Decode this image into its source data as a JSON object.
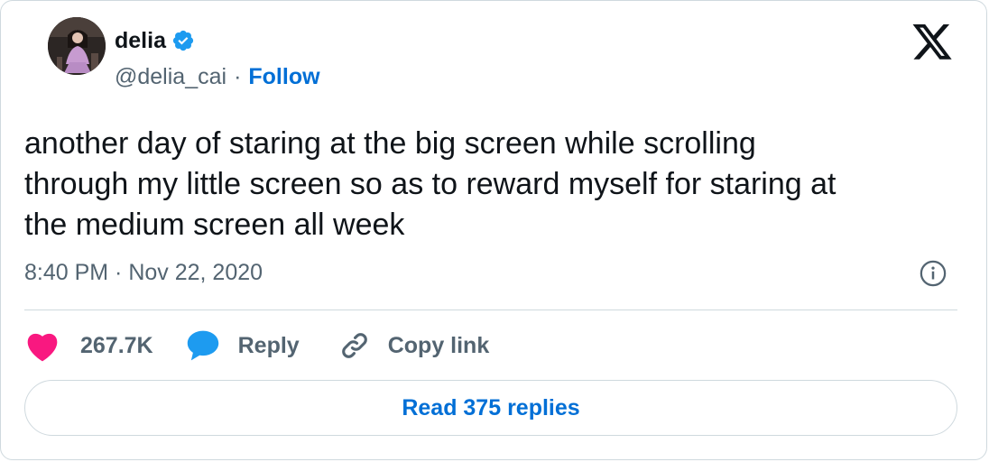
{
  "author": {
    "name": "delia",
    "handle": "@delia_cai",
    "separator": "·",
    "follow_label": "Follow"
  },
  "tweet": {
    "text": "another day of staring at the big screen while scrolling\nthrough my little screen so as to reward myself for staring at\nthe medium screen all week",
    "timestamp": "8:40 PM · Nov 22, 2020"
  },
  "actions": {
    "like_count": "267.7K",
    "reply_label": "Reply",
    "copy_link_label": "Copy link"
  },
  "read_replies_label": "Read 375 replies",
  "icons": {
    "verified": "verified-badge-icon",
    "logo": "x-logo-icon",
    "info": "info-icon",
    "like": "heart-icon",
    "reply": "speech-bubble-icon",
    "copy": "link-icon"
  },
  "colors": {
    "accent": "#006fd6",
    "verified": "#1d9bf0",
    "heart": "#f91880",
    "muted": "#536471",
    "border": "#cfd9de"
  }
}
